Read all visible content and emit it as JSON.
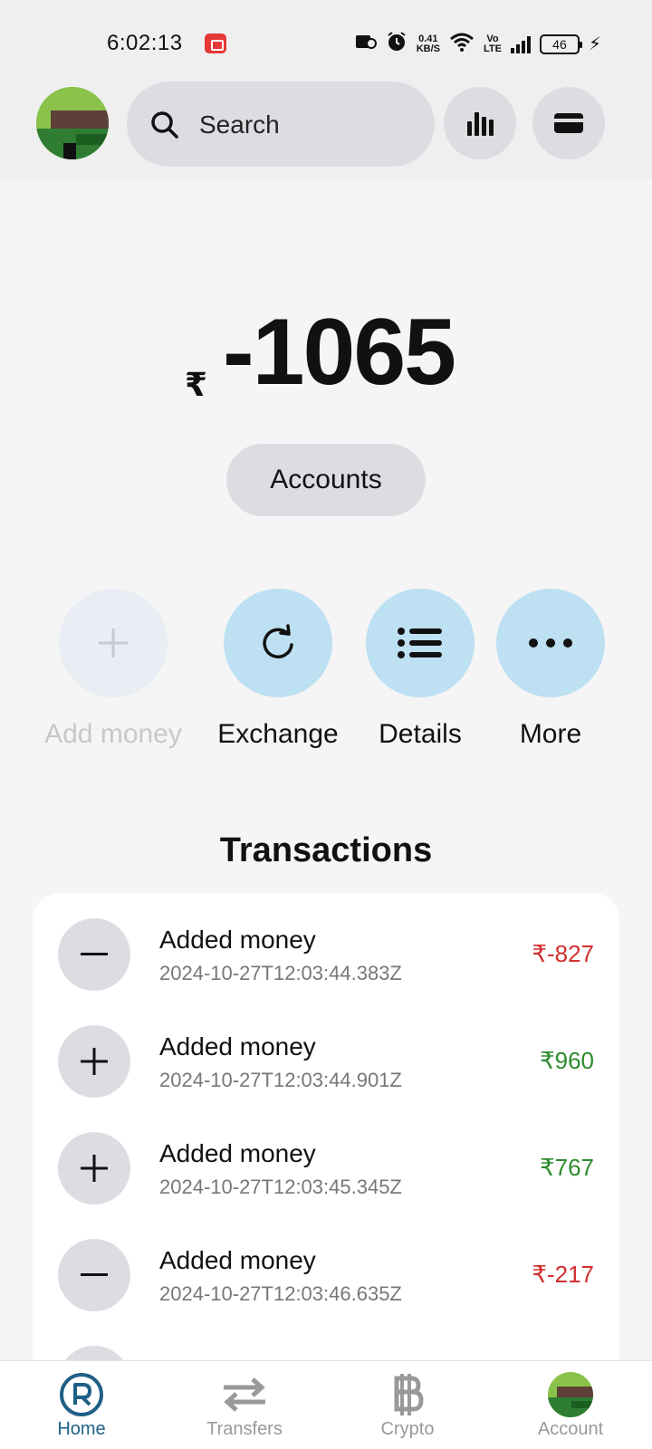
{
  "status_bar": {
    "time": "6:02:13",
    "net_speed_value": "0.41",
    "net_speed_unit": "KB/S",
    "volte_top": "Vo",
    "volte_bottom": "LTE",
    "battery": "46"
  },
  "header": {
    "search_placeholder": "Search"
  },
  "balance": {
    "currency": "₹",
    "value": "-1065"
  },
  "accounts_button": "Accounts",
  "actions": [
    {
      "label": "Add money",
      "enabled": false
    },
    {
      "label": "Exchange",
      "enabled": true
    },
    {
      "label": "Details",
      "enabled": true
    },
    {
      "label": "More",
      "enabled": true
    }
  ],
  "transactions": {
    "title": "Transactions",
    "items": [
      {
        "name": "Added money",
        "date": "2024-10-27T12:03:44.383Z",
        "amount": "₹-827",
        "type": "debit"
      },
      {
        "name": "Added money",
        "date": "2024-10-27T12:03:44.901Z",
        "amount": "₹960",
        "type": "credit"
      },
      {
        "name": "Added money",
        "date": "2024-10-27T12:03:45.345Z",
        "amount": "₹767",
        "type": "credit"
      },
      {
        "name": "Added money",
        "date": "2024-10-27T12:03:46.635Z",
        "amount": "₹-217",
        "type": "debit"
      }
    ]
  },
  "bottom_nav": [
    {
      "label": "Home",
      "active": true
    },
    {
      "label": "Transfers",
      "active": false
    },
    {
      "label": "Crypto",
      "active": false
    },
    {
      "label": "Account",
      "active": false
    }
  ],
  "colors": {
    "accent": "#1e5f86",
    "action_bg": "#bde0f2",
    "debit": "#d32f2f",
    "credit": "#2e8b2e"
  }
}
